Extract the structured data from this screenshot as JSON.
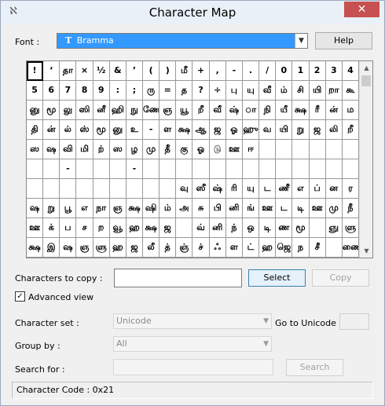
{
  "window": {
    "title": "Character Map",
    "app_icon": "character-map-icon",
    "close_glyph": "✕"
  },
  "font": {
    "label": "Font :",
    "selected": "Bramma",
    "type_icon": "truetype-icon",
    "help_label": "Help"
  },
  "grid": {
    "selected_index": 0,
    "cells": [
      "!",
      "‘",
      "தா",
      "×",
      "½",
      "&",
      "’",
      "(",
      ")",
      "மீ",
      "+",
      ",",
      "-",
      ".",
      "/",
      "0",
      "1",
      "2",
      "3",
      "4",
      "5",
      "6",
      "7",
      "8",
      "9",
      ":",
      ";",
      "ரு",
      "=",
      "த",
      "?",
      "÷",
      "பு",
      "யு",
      "வீ",
      "ம்",
      "சி",
      "யி",
      "றா",
      "கூ",
      "னு",
      "மூ",
      "லு",
      "ஸி",
      "னீ",
      "ஹி",
      "நு",
      "ணே",
      "ஞ",
      "யூ",
      "றீ",
      "வீ",
      "ஷ்",
      "ா",
      "நி",
      "யீ",
      "க்ஷ",
      "ரீ",
      "ன்",
      "ம",
      "தி",
      "ன்",
      "ல்",
      "ஸ்",
      "மூ",
      "னு",
      "உ",
      "-",
      "ள",
      "க்ஷ",
      "ஆ",
      "ஜ",
      "ஓ",
      "ஹு",
      "வ",
      "யி",
      "று",
      "ஜ",
      "லி",
      "றீ",
      "ஸ",
      "ஷ",
      "வி",
      "மி",
      "ற்",
      "ஸ",
      "ழ",
      "மு",
      "தீ",
      "கு",
      "ஓ",
      "டு",
      "ஊ",
      "ஈ",
      "",
      "",
      "",
      "",
      "",
      "",
      "",
      "",
      "-",
      "",
      "",
      "",
      "-",
      "",
      "",
      "",
      "",
      "",
      "",
      "",
      "",
      "",
      "",
      "",
      "",
      "",
      "",
      "",
      "",
      "",
      "",
      "",
      "",
      "",
      "",
      "வு",
      "ஸீ",
      "ஷ்",
      "ரி",
      "யு",
      "ட",
      "ணீ",
      "எ",
      "ப்",
      "ன",
      "ர",
      "ஷ",
      "று",
      "பூ",
      "எ",
      "நா",
      "ஞ",
      "க்ஷ",
      "ஷி",
      "ம்",
      "அ",
      "சு",
      "பி",
      "னி",
      "ங்",
      "ஊ",
      "ட",
      "டி",
      "ஊ",
      "மு",
      "நீ",
      "ஊ",
      "க்",
      "ப",
      "ச",
      "ற",
      "வூ",
      "ஹ",
      "க்ஷ",
      "ஜ",
      "",
      "வ்",
      "னி",
      "ந்",
      "ஒ",
      "டி",
      "ண",
      "மூ",
      "",
      "ஞு",
      "ளு",
      "க்ஷ",
      "இ",
      "ஷ",
      "ஞ",
      "ளு",
      "ஹ",
      "ஜ",
      "லீ",
      "த்",
      "ஞ்",
      "ச்",
      "ஃ",
      "ள",
      "ட்",
      "ஹ",
      "ஜெ",
      "ந",
      "சீ",
      "",
      "ணை"
    ]
  },
  "copy": {
    "label": "Characters to copy :",
    "value": "",
    "select_label": "Select",
    "copy_label": "Copy"
  },
  "advanced": {
    "label": "Advanced view",
    "checked": true,
    "check_glyph": "✓"
  },
  "charset": {
    "label": "Character set :",
    "value": "Unicode"
  },
  "goto_unicode": {
    "label": "Go to Unicode :",
    "value": ""
  },
  "groupby": {
    "label": "Group by :",
    "value": "All"
  },
  "search": {
    "label": "Search for :",
    "value": "",
    "button_label": "Search"
  },
  "status": {
    "text": "Character Code : 0x21"
  },
  "icons": {
    "scroll_up": "▲",
    "scroll_down": "▼",
    "combo_arrow": "▼"
  }
}
